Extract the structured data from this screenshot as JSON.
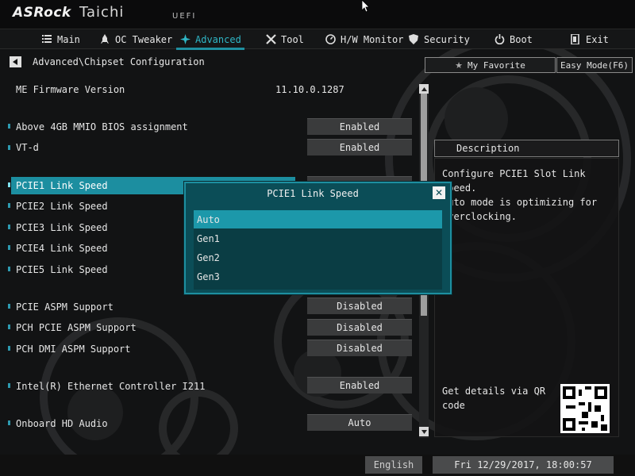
{
  "header": {
    "brand": "ASRock",
    "model": "Taichi",
    "firmware_label": "UEFI"
  },
  "nav": {
    "tabs": [
      {
        "label": "Main",
        "icon": "list-icon",
        "active": false
      },
      {
        "label": "OC Tweaker",
        "icon": "rocket-icon",
        "active": false
      },
      {
        "label": "Advanced",
        "icon": "star-icon",
        "active": true
      },
      {
        "label": "Tool",
        "icon": "wrench-icon",
        "active": false
      },
      {
        "label": "H/W Monitor",
        "icon": "monitor-icon",
        "active": false
      },
      {
        "label": "Security",
        "icon": "shield-icon",
        "active": false
      },
      {
        "label": "Boot",
        "icon": "power-icon",
        "active": false
      },
      {
        "label": "Exit",
        "icon": "exit-icon",
        "active": false
      }
    ]
  },
  "breadcrumb": "Advanced\\Chipset Configuration",
  "toolbar": {
    "favorite_label": "My Favorite",
    "easy_mode_label": "Easy Mode(F6)"
  },
  "settings": {
    "me_firmware": {
      "label": "ME Firmware Version",
      "value": "11.10.0.1287"
    },
    "above4g": {
      "label": "Above 4GB MMIO BIOS assignment",
      "value": "Enabled"
    },
    "vtd": {
      "label": "VT-d",
      "value": "Enabled"
    },
    "pcie1": {
      "label": "PCIE1 Link Speed",
      "value": "Auto"
    },
    "pcie2": {
      "label": "PCIE2 Link Speed"
    },
    "pcie3": {
      "label": "PCIE3 Link Speed"
    },
    "pcie4": {
      "label": "PCIE4 Link Speed"
    },
    "pcie5": {
      "label": "PCIE5 Link Speed"
    },
    "pcie_aspm": {
      "label": "PCIE ASPM Support",
      "value": "Disabled"
    },
    "pch_pcie_aspm": {
      "label": "PCH PCIE ASPM Support",
      "value": "Disabled"
    },
    "pch_dmi_aspm": {
      "label": "PCH DMI ASPM Support",
      "value": "Disabled"
    },
    "ethernet": {
      "label": "Intel(R) Ethernet Controller I211",
      "value": "Enabled"
    },
    "hd_audio": {
      "label": "Onboard HD Audio",
      "value": "Auto"
    }
  },
  "description": {
    "title": "Description",
    "text": "Configure PCIE1 Slot Link Speed.\nAuto mode is optimizing for\noverclocking.",
    "qr_label": "Get details via QR code"
  },
  "popup": {
    "title": "PCIE1 Link Speed",
    "options": [
      "Auto",
      "Gen1",
      "Gen2",
      "Gen3"
    ],
    "selected": "Auto"
  },
  "footer": {
    "language": "English",
    "datetime": "Fri 12/29/2017, 18:00:57"
  },
  "colors": {
    "accent": "#1c8ea0",
    "popup_bg": "#0b4d57",
    "value_box": "#3a3b3c",
    "background": "#121314"
  }
}
